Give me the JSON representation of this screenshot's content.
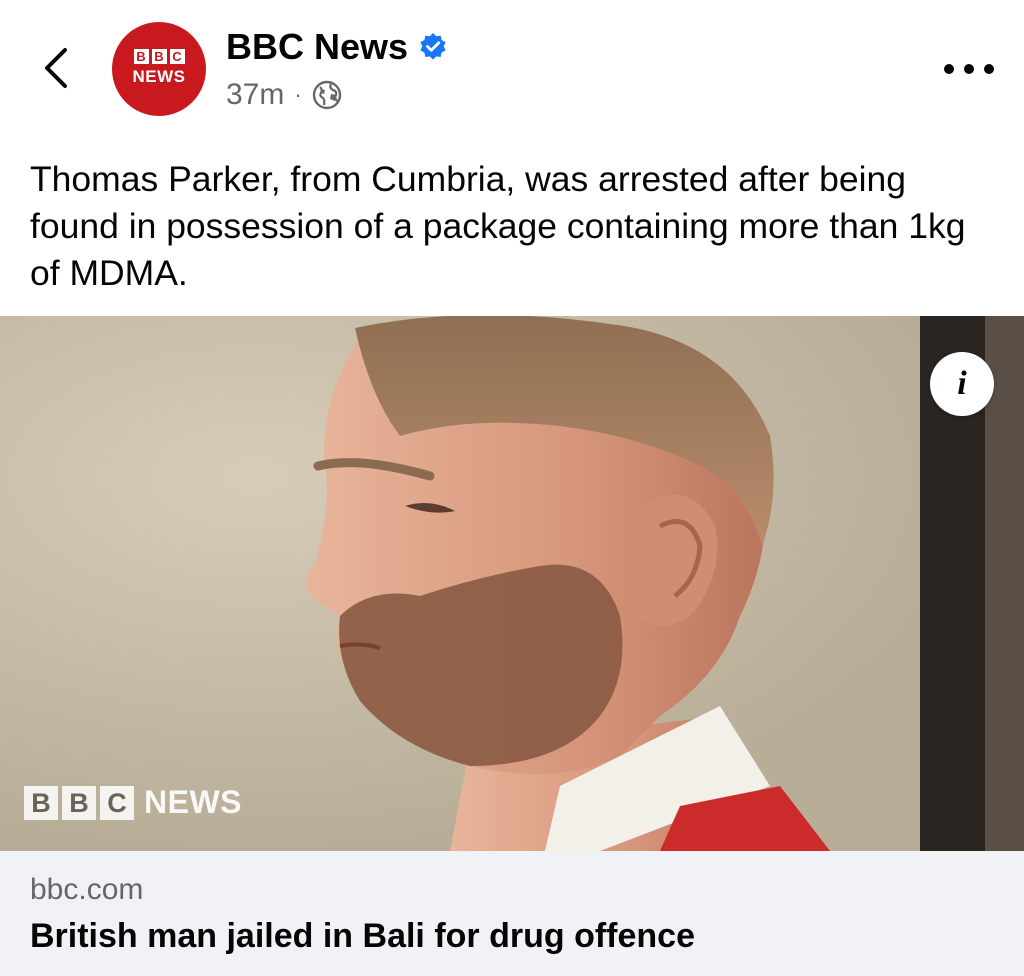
{
  "header": {
    "page_name": "BBC News",
    "avatar_blocks": [
      "B",
      "B",
      "C"
    ],
    "avatar_news": "NEWS",
    "timestamp": "37m",
    "separator": "·",
    "audience_icon": "globe-icon",
    "verified_icon": "verified-badge-icon",
    "more_icon": "more-options-icon",
    "back_icon": "chevron-left-icon"
  },
  "post": {
    "text": "Thomas Parker, from Cumbria, was arrested after being found in possession of a package containing more than 1kg of MDMA."
  },
  "image": {
    "info_label": "i",
    "watermark_blocks": [
      "B",
      "B",
      "C"
    ],
    "watermark_news": "NEWS"
  },
  "link_preview": {
    "domain": "bbc.com",
    "title": "British man jailed in Bali for drug offence"
  },
  "colors": {
    "brand_red": "#c8191e",
    "verified_blue": "#1877f2",
    "secondary_text": "#65676b",
    "link_card_bg": "#f0f2f5"
  }
}
